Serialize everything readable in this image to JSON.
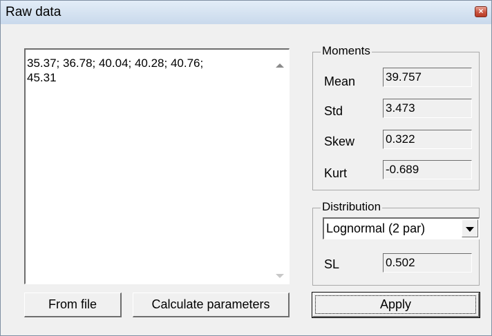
{
  "window": {
    "title": "Raw data"
  },
  "memo": {
    "text": "35.37; 36.78; 40.04; 40.28; 40.76;\n45.31"
  },
  "moments": {
    "legend": "Moments",
    "mean": {
      "label": "Mean",
      "value": "39.757"
    },
    "std": {
      "label": "Std",
      "value": "3.473"
    },
    "skew": {
      "label": "Skew",
      "value": "0.322"
    },
    "kurt": {
      "label": "Kurt",
      "value": "-0.689"
    }
  },
  "distribution": {
    "legend": "Distribution",
    "selected": "Lognormal (2 par)",
    "sl": {
      "label": "SL",
      "value": "0.502"
    }
  },
  "buttons": {
    "from_file": "From file",
    "calculate": "Calculate parameters",
    "apply": "Apply"
  }
}
